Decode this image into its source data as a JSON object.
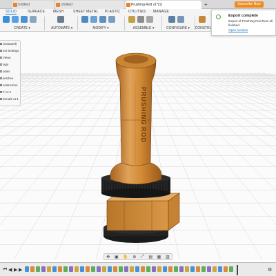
{
  "browser_tabs": [
    {
      "label": "Untitled"
    },
    {
      "label": "Untitled"
    },
    {
      "label": "Prushing Rod v1*(1)"
    }
  ],
  "subscribe_label": "Subscribe Now",
  "toolbar": {
    "tabs": [
      "SOLID",
      "SURFACE",
      "MESH",
      "SHEET METAL",
      "PLASTIC",
      "UTILITIES",
      "MANAGE"
    ],
    "active_tab": "SOLID",
    "groups": {
      "create": "CREATE ▾",
      "automate": "AUTOMATE ▾",
      "modify": "MODIFY ▾",
      "assemble": "ASSEMBLE ▾",
      "configure": "CONFIGURE ▾",
      "construct": "CONSTRU"
    }
  },
  "browser": {
    "items": [
      "(Unsaved)",
      "ent Settings",
      "Views",
      "rigin",
      "odies",
      "ketches",
      "onstruction",
      "F v1:1",
      "ternal2 v1:1"
    ]
  },
  "notification": {
    "title": "Export complete",
    "message": "Export of Prushing Rod Reel all finished.",
    "link": "Open location"
  },
  "model": {
    "text_upper": "PRUSHING",
    "text_lower": "ROD",
    "body_color": "#d9913f",
    "dark_color": "#1a1a1a"
  },
  "timeline": {
    "feature_count": 38
  },
  "colors": {
    "accent": "#1675c6",
    "subscribe": "#f08a1e",
    "success": "#4aa03a"
  }
}
